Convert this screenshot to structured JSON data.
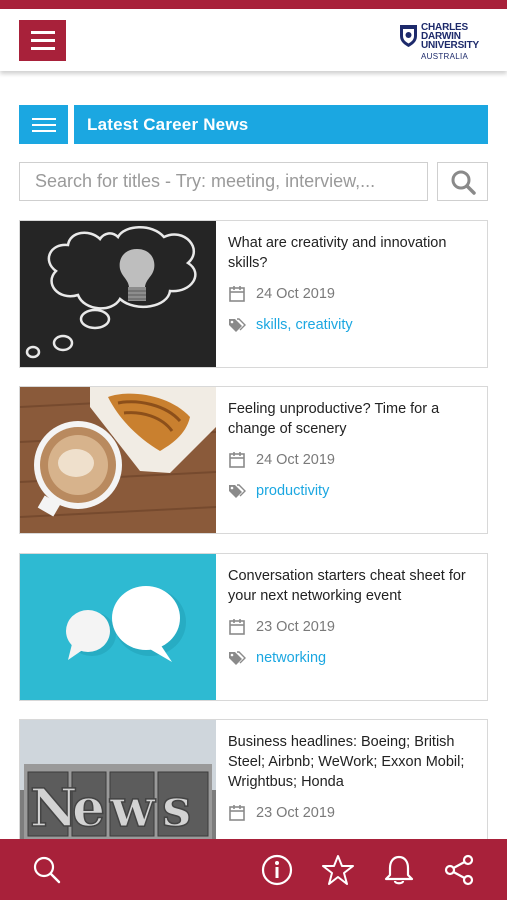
{
  "header": {
    "menu_label": "menu",
    "logo": {
      "line1": "CHARLES",
      "line2": "DARWIN",
      "line3": "UNIVERSITY",
      "country": "AUSTRALIA"
    }
  },
  "news_bar": {
    "title": "Latest Career News"
  },
  "search": {
    "placeholder": "Search for titles - Try: meeting, interview,..."
  },
  "articles": [
    {
      "title": "What are creativity and innovation skills?",
      "date": "24 Oct 2019",
      "tags": "skills, creativity",
      "image": "lightbulb-thought-cloud"
    },
    {
      "title": "Feeling unproductive? Time for a change of scenery",
      "date": "24 Oct 2019",
      "tags": "productivity",
      "image": "coffee-and-croissant"
    },
    {
      "title": "Conversation starters cheat sheet for your next networking event",
      "date": "23 Oct 2019",
      "tags": "networking",
      "image": "speech-bubbles"
    },
    {
      "title": "Business headlines: Boeing; British Steel; Airbnb; WeWork; Exxon Mobil; Wrightbus; Honda",
      "date": "23 Oct 2019",
      "tags": "",
      "image": "news-letterpress"
    }
  ],
  "bottom_nav": [
    "search-icon",
    "info-icon",
    "star-icon",
    "bell-icon",
    "share-icon"
  ],
  "colors": {
    "brand_red": "#a8213a",
    "accent_blue": "#1ba7e1"
  }
}
